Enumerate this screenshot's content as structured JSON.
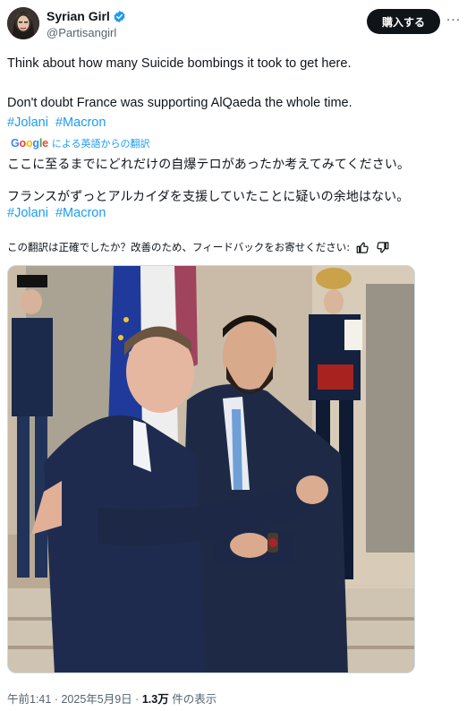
{
  "author": {
    "display_name": "Syrian Girl",
    "handle": "@Partisangirl",
    "verified": true
  },
  "actions": {
    "subscribe_label": "購入する",
    "more_label": "···"
  },
  "tweet": {
    "line1": "Think about how many Suicide bombings it took to get here.",
    "line2": "Don't doubt France was supporting AlQaeda the whole time.",
    "hashtags": [
      "#Jolani",
      "#Macron"
    ]
  },
  "translation": {
    "provider": "Google",
    "provider_label": "による英語からの翻訳",
    "line1": "ここに至るまでにどれだけの自爆テロがあったか考えてみてください。",
    "line2": "フランスがずっとアルカイダを支援していたことに疑いの余地はない。",
    "hashtags": [
      "#Jolani",
      "#Macron"
    ],
    "feedback_prompt": "この翻訳は正確でしたか？改善のため、フィードバックをお寄せください:"
  },
  "footer": {
    "time": "午前1:41",
    "date": "2025年5月9日",
    "views": "1.3万",
    "views_label": "件の表示"
  },
  "colors": {
    "link": "#1d9bf0",
    "text": "#0f1419",
    "secondary": "#536471",
    "verified": "#1d9bf0"
  }
}
